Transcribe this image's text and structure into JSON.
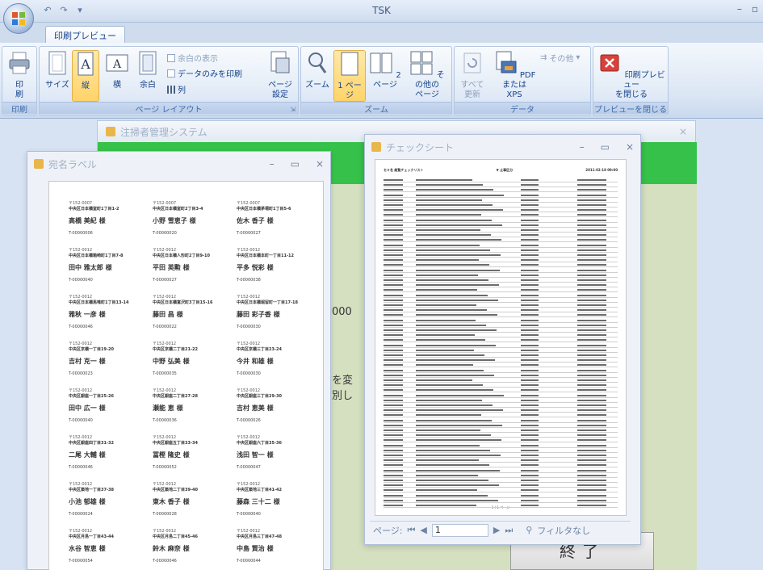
{
  "window": {
    "title": "TSK"
  },
  "tabs": {
    "active": "印刷プレビュー"
  },
  "ribbon": {
    "print": {
      "button": "印\n刷",
      "group": "印刷"
    },
    "page_layout": {
      "size": "サイズ",
      "portrait": "縦",
      "landscape": "横",
      "margins": "余白",
      "show_margins": "余白の表示",
      "print_data_only": "データのみを印刷",
      "columns": "列",
      "page_setup": "ページ\n設定",
      "group": "ページ レイアウト"
    },
    "zoom": {
      "zoom": "ズーム",
      "one_page": "1 ページ",
      "two_pages": "2 ページ",
      "more_pages": "その他の\nページ",
      "group": "ズーム"
    },
    "data": {
      "refresh_all": "すべて\n更新",
      "pdf_xps": "PDF または\nXPS",
      "other": "その他",
      "group": "データ"
    },
    "close": {
      "button": "印刷プレビュー\nを閉じる",
      "group": "プレビューを閉じる"
    }
  },
  "main_window": {
    "title": "注掃者管理システム",
    "fragment_1": "000",
    "fragment_2": "を変",
    "fragment_3": "別し",
    "exit_label": "終了"
  },
  "label_window": {
    "title": "宛名ラベル",
    "labels": [
      {
        "zip": "〒152-0007",
        "addr": "中央区日本橋室町1丁目1-2",
        "name": "高橋 美紀 様",
        "code": "T-00000006"
      },
      {
        "zip": "〒152-0007",
        "addr": "中央区日本橋室町2丁目3-4",
        "name": "小野 雪恵子 様",
        "code": "T-00000020"
      },
      {
        "zip": "〒152-0007",
        "addr": "中央区日本橋茅場町1丁目5-6",
        "name": "佐木 香子 様",
        "code": "T-00000027"
      },
      {
        "zip": "〒152-0012",
        "addr": "中央区日本橋箱崎町1丁目7-8",
        "name": "田中 雅太郎 様",
        "code": "T-00000040"
      },
      {
        "zip": "〒152-0012",
        "addr": "中央区日本橋人形町2丁目9-10",
        "name": "平田 英勲 様",
        "code": "T-00000027"
      },
      {
        "zip": "〒152-0012",
        "addr": "中央区日本橋本町一丁目11-12",
        "name": "平多 悦彩 様",
        "code": "T-00000038"
      },
      {
        "zip": "〒152-0012",
        "addr": "中央区日本橋馬喰町1丁目13-14",
        "name": "雅秋 一彦 様",
        "code": "T-00000046"
      },
      {
        "zip": "〒152-0012",
        "addr": "中央区日本橋富沢町3丁目15-16",
        "name": "藤田 昌 様",
        "code": "T-00000022"
      },
      {
        "zip": "〒152-0012",
        "addr": "中央区日本橋堀留町一丁目17-18",
        "name": "藤田 彩子香 様",
        "code": "T-00000030"
      },
      {
        "zip": "〒152-0012",
        "addr": "中央区京橋一丁目19-20",
        "name": "吉村 克一 様",
        "code": "T-00000023"
      },
      {
        "zip": "〒152-0012",
        "addr": "中央区京橋二丁目21-22",
        "name": "中野 弘美 様",
        "code": "T-00000035"
      },
      {
        "zip": "〒152-0012",
        "addr": "中央区京橋三丁目23-24",
        "name": "今井 和雄 様",
        "code": "T-00000030"
      },
      {
        "zip": "〒152-0012",
        "addr": "中央区銀座一丁目25-26",
        "name": "田中 広一 様",
        "code": "T-00000040"
      },
      {
        "zip": "〒152-0012",
        "addr": "中央区銀座二丁目27-28",
        "name": "瀬能 恵 様",
        "code": "T-00000036"
      },
      {
        "zip": "〒152-0012",
        "addr": "中央区銀座三丁目29-30",
        "name": "吉村 恵美 様",
        "code": "T-00000026"
      },
      {
        "zip": "〒152-0012",
        "addr": "中央区銀座四丁目31-32",
        "name": "二尾 大輔 様",
        "code": "T-00000046"
      },
      {
        "zip": "〒152-0012",
        "addr": "中央区銀座五丁目33-34",
        "name": "冨樫 隆史 様",
        "code": "T-00000052"
      },
      {
        "zip": "〒152-0012",
        "addr": "中央区銀座六丁目35-36",
        "name": "浅田 智一 様",
        "code": "T-00000047"
      },
      {
        "zip": "〒152-0012",
        "addr": "中央区築地一丁目37-38",
        "name": "小池 郁雄 様",
        "code": "T-00000024"
      },
      {
        "zip": "〒152-0012",
        "addr": "中央区築地二丁目39-40",
        "name": "東木 香子 様",
        "code": "T-00000028"
      },
      {
        "zip": "〒152-0012",
        "addr": "中央区築地三丁目41-42",
        "name": "藤森 三十二 様",
        "code": "T-00000040"
      },
      {
        "zip": "〒152-0012",
        "addr": "中央区月島一丁目43-44",
        "name": "水谷 智恵 様",
        "code": "T-00000054"
      },
      {
        "zip": "〒152-0012",
        "addr": "中央区月島二丁目45-46",
        "name": "鈴木 麻奈 様",
        "code": "T-00000046"
      },
      {
        "zip": "〒152-0012",
        "addr": "中央区月島三丁目47-48",
        "name": "中島 賢治 様",
        "code": "T-00000044"
      }
    ]
  },
  "check_window": {
    "title": "チェックシート",
    "head_left": "セミ名 総覧チェックリスト",
    "head_mid": "▼ 止事区分",
    "head_right": "2011-02-18 09:00",
    "footer": "1 / 1 ページ",
    "nav": {
      "label": "ページ:",
      "page": "1",
      "filter": "フィルタなし"
    }
  },
  "colors": {
    "accent": "#36c24a",
    "ribbon_text": "#15428b"
  }
}
